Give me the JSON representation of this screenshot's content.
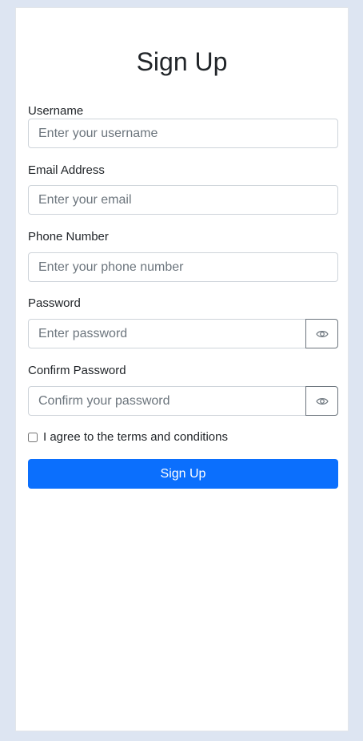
{
  "form": {
    "title": "Sign Up",
    "fields": {
      "username": {
        "label": "Username",
        "value": "",
        "placeholder": "Enter your username"
      },
      "email": {
        "label": "Email Address",
        "value": "",
        "placeholder": "Enter your email"
      },
      "phone": {
        "label": "Phone Number",
        "value": "",
        "placeholder": "Enter your phone number"
      },
      "password": {
        "label": "Password",
        "value": "",
        "placeholder": "Enter password",
        "toggle_icon": "eye-icon"
      },
      "confirm_password": {
        "label": "Confirm Password",
        "value": "",
        "placeholder": "Confirm your password",
        "toggle_icon": "eye-icon"
      }
    },
    "terms": {
      "label": "I agree to the terms and conditions",
      "checked": false
    },
    "submit_label": "Sign Up"
  },
  "colors": {
    "background": "#dde5f2",
    "card": "#ffffff",
    "primary": "#0b6ffd",
    "text": "#212529",
    "placeholder": "#6c757d"
  }
}
